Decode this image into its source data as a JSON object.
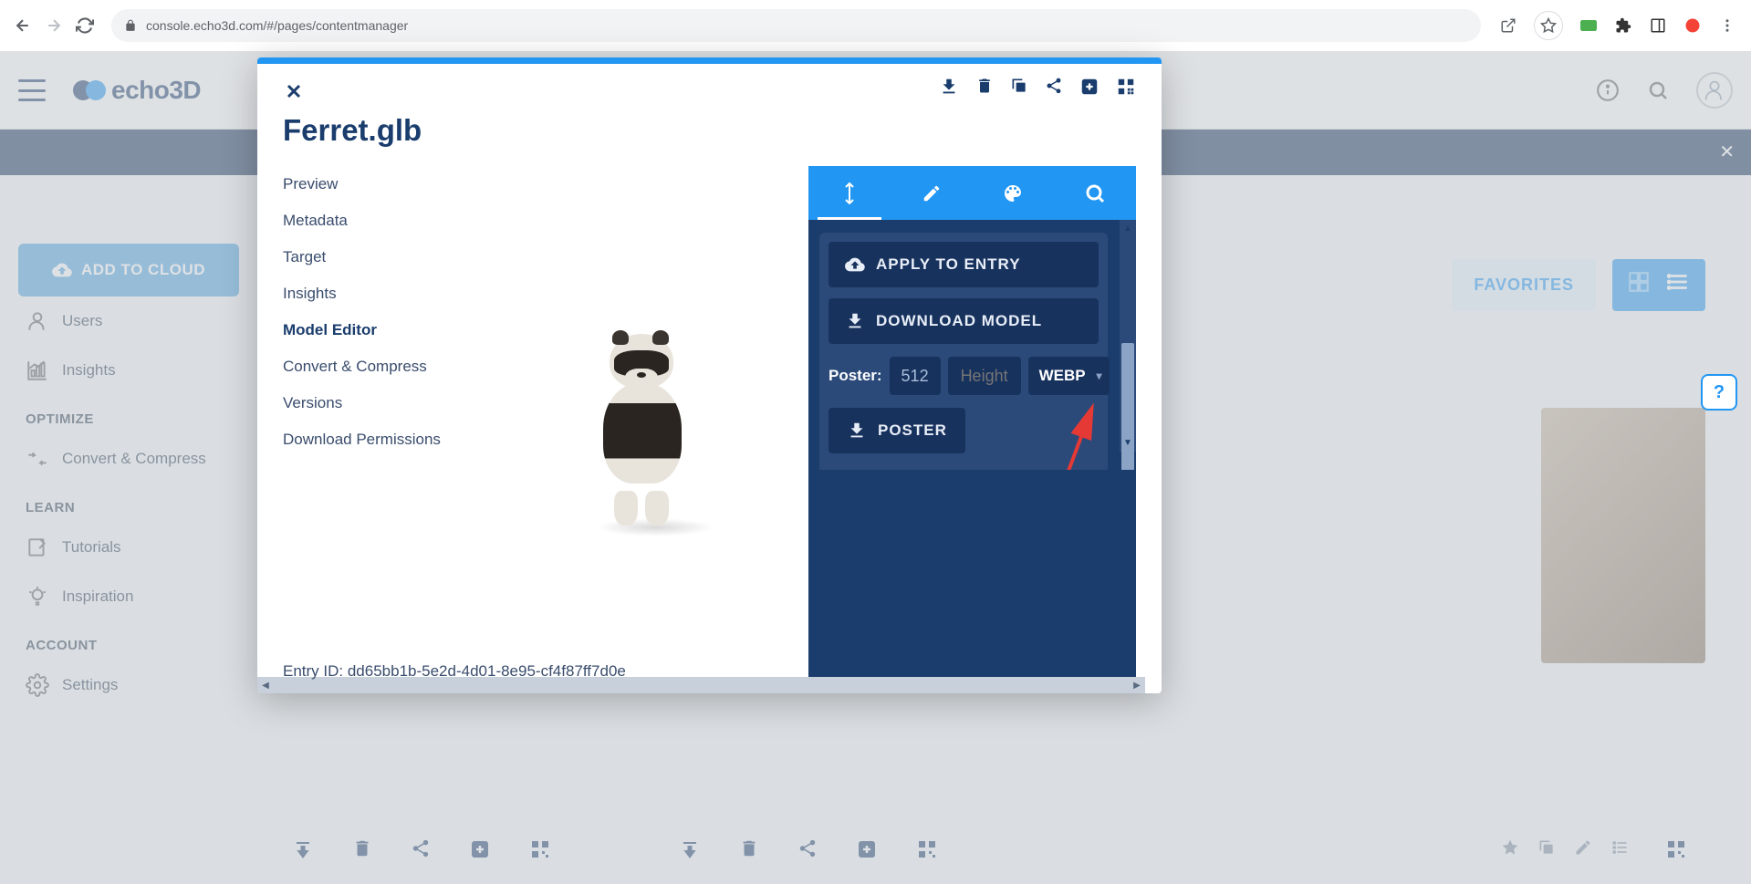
{
  "browser": {
    "url": "console.echo3d.com/#/pages/contentmanager"
  },
  "app": {
    "logo_text": "echo3D",
    "add_to_cloud": "ADD TO CLOUD",
    "favorites": "FAVORITES"
  },
  "sidebar": {
    "items": [
      {
        "label": "Users"
      },
      {
        "label": "Insights"
      }
    ],
    "sections": {
      "optimize": "OPTIMIZE",
      "learn": "LEARN",
      "account": "ACCOUNT"
    },
    "optimize_items": [
      {
        "label": "Convert & Compress"
      }
    ],
    "learn_items": [
      {
        "label": "Tutorials"
      },
      {
        "label": "Inspiration"
      }
    ],
    "account_items": [
      {
        "label": "Settings"
      }
    ]
  },
  "modal": {
    "title": "Ferret.glb",
    "tabs": [
      {
        "label": "Preview"
      },
      {
        "label": "Metadata"
      },
      {
        "label": "Target"
      },
      {
        "label": "Insights"
      },
      {
        "label": "Model Editor"
      },
      {
        "label": "Convert & Compress"
      },
      {
        "label": "Versions"
      },
      {
        "label": "Download Permissions"
      }
    ],
    "panel": {
      "apply": "APPLY TO ENTRY",
      "download": "DOWNLOAD MODEL",
      "poster_label": "Poster:",
      "poster_width": "512",
      "poster_height_placeholder": "Height",
      "format": "WEBP",
      "poster_btn": "POSTER"
    },
    "entry_id": "Entry ID: dd65bb1b-5e2d-4d01-8e95-cf4f87ff7d0e"
  }
}
